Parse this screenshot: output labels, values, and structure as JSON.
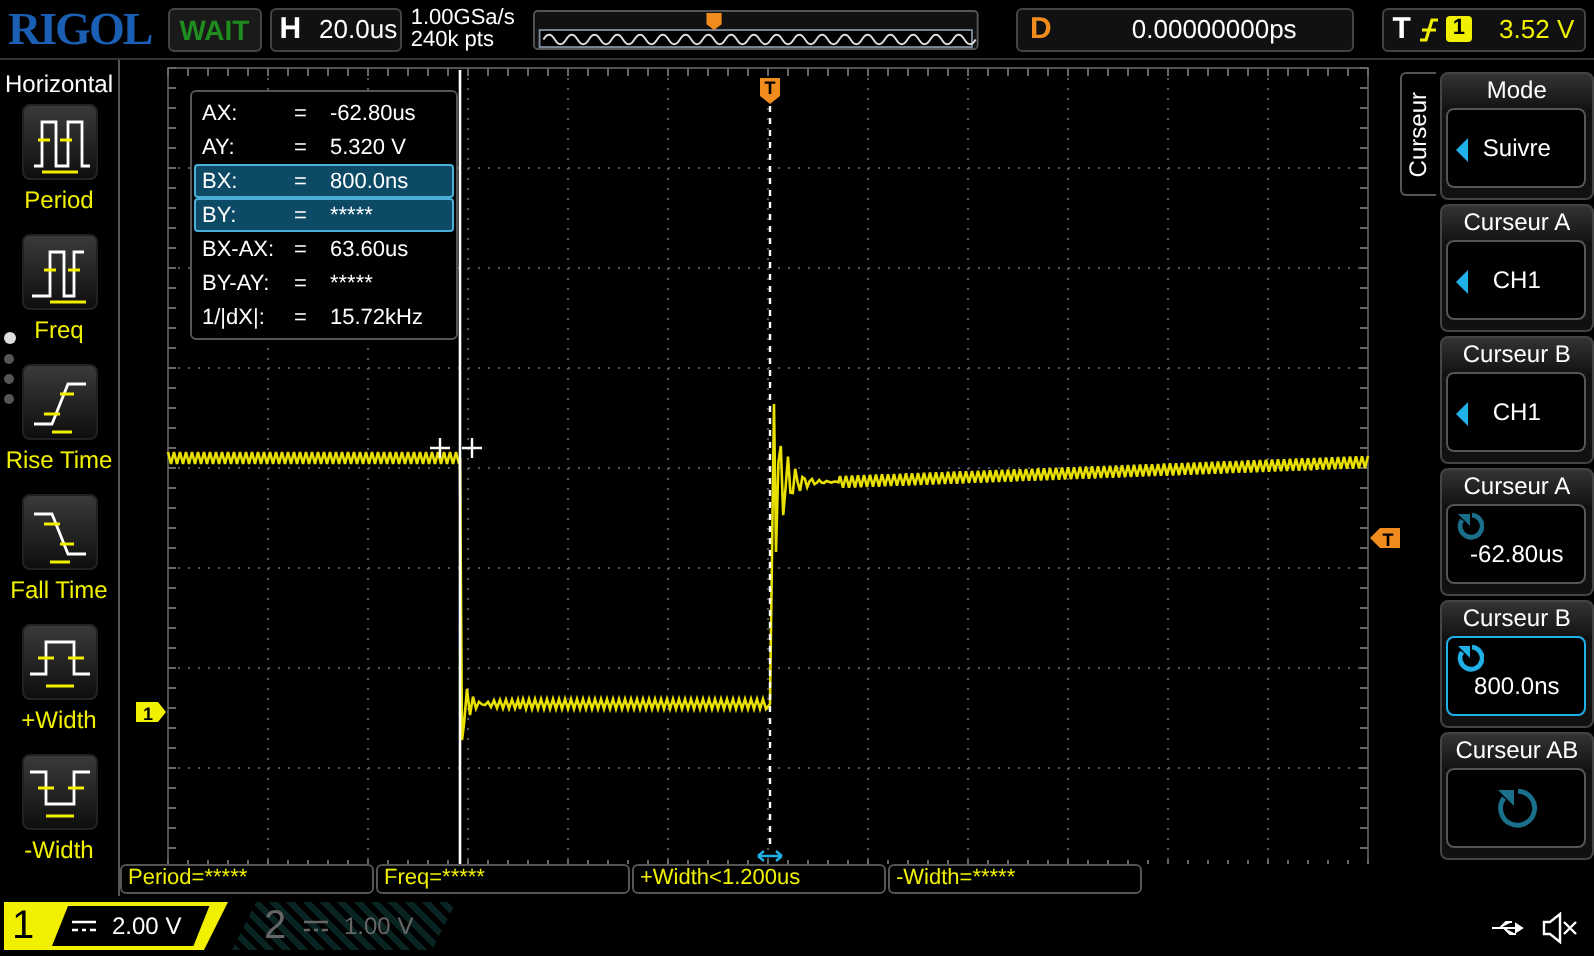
{
  "header": {
    "logo": "RIGOL",
    "run_status": "WAIT",
    "timebase": {
      "label": "H",
      "value": "20.0us"
    },
    "sample_rate": "1.00GSa/s",
    "memory_depth": "240k pts",
    "delay": {
      "label": "D",
      "value": "0.00000000ps"
    },
    "trigger": {
      "label": "T",
      "channel": "1",
      "level": "3.52 V"
    }
  },
  "left_menu": {
    "title": "Horizontal",
    "page_dots": [
      {
        "selected": true
      },
      {
        "selected": false
      },
      {
        "selected": false
      },
      {
        "selected": false
      }
    ],
    "items": [
      {
        "label": "Period",
        "kind": "period"
      },
      {
        "label": "Freq",
        "kind": "freq"
      },
      {
        "label": "Rise Time",
        "kind": "rise"
      },
      {
        "label": "Fall Time",
        "kind": "fall"
      },
      {
        "label": "+Width",
        "kind": "pwidth"
      },
      {
        "label": "-Width",
        "kind": "nwidth"
      }
    ]
  },
  "plot": {
    "trigger_position_marker": "T",
    "trigger_level_marker": "T",
    "channel_marker": "1",
    "readout": [
      {
        "name": "AX:",
        "sign": "=",
        "value": "-62.80us",
        "selected": false
      },
      {
        "name": "AY:",
        "sign": "=",
        "value": "5.320 V",
        "selected": false
      },
      {
        "name": "BX:",
        "sign": "=",
        "value": "800.0ns",
        "selected": true
      },
      {
        "name": "BY:",
        "sign": "=",
        "value": "*****",
        "selected": true
      },
      {
        "name": "BX-AX:",
        "sign": "=",
        "value": "63.60us",
        "selected": false
      },
      {
        "name": "BY-AY:",
        "sign": "=",
        "value": "*****",
        "selected": false
      },
      {
        "name": "1/|dX|:",
        "sign": "=",
        "value": "15.72kHz",
        "selected": false
      }
    ]
  },
  "measurements": [
    "Period=*****",
    "Freq=*****",
    "+Width<1.200us",
    "-Width=*****"
  ],
  "channels": [
    {
      "number": "1",
      "scale": "2.00 V",
      "on": true
    },
    {
      "number": "2",
      "scale": "1.00 V",
      "on": false
    }
  ],
  "right_menu": {
    "tab": "Curseur",
    "items": [
      {
        "title": "Mode",
        "kind": "option",
        "value": "Suivre",
        "selected": false
      },
      {
        "title": "Curseur A",
        "kind": "option",
        "value": "CH1",
        "selected": false
      },
      {
        "title": "Curseur B",
        "kind": "option",
        "value": "CH1",
        "selected": false
      },
      {
        "title": "Curseur A",
        "kind": "knob",
        "value": "-62.80us",
        "selected": false
      },
      {
        "title": "Curseur B",
        "kind": "knob",
        "value": "800.0ns",
        "selected": true
      },
      {
        "title": "Curseur AB",
        "kind": "knob",
        "selected": false
      }
    ]
  }
}
